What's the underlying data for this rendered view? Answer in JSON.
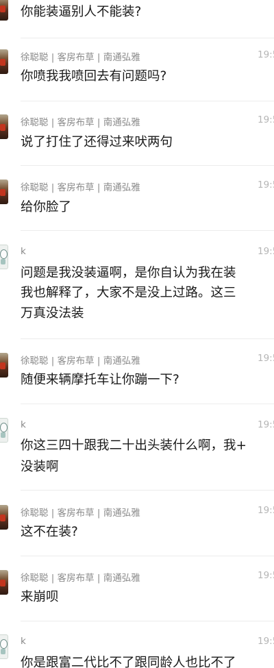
{
  "messages": [
    {
      "sender": "",
      "time": "",
      "lines": [
        "你能装逼别人不能装?"
      ]
    },
    {
      "sender": "徐聪聪 | 客房布草 | 南通弘雅",
      "time": "19:5",
      "lines": [
        "你喷我我喷回去有问题吗?"
      ]
    },
    {
      "sender": "徐聪聪 | 客房布草 | 南通弘雅",
      "time": "19:5",
      "lines": [
        "说了打住了还得过来吠两句"
      ]
    },
    {
      "sender": "徐聪聪 | 客房布草 | 南通弘雅",
      "time": "19:5",
      "lines": [
        "给你脸了"
      ]
    },
    {
      "sender": "k",
      "time": "19:5",
      "lines": [
        "问题是我没装逼啊，是你自认为我在装",
        "我也解释了，大家不是没上过路。这三",
        "万真没法装"
      ]
    },
    {
      "sender": "徐聪聪 | 客房布草 | 南通弘雅",
      "time": "19:5",
      "lines": [
        "随便来辆摩托车让你蹦一下?"
      ]
    },
    {
      "sender": "k",
      "time": "19:5",
      "lines": [
        "你这三四十跟我二十出头装什么啊，我+",
        "没装啊"
      ]
    },
    {
      "sender": "徐聪聪 | 客房布草 | 南通弘雅",
      "time": "19:5",
      "lines": [
        "这不在装?"
      ]
    },
    {
      "sender": "徐聪聪 | 客房布草 | 南通弘雅",
      "time": "19:5",
      "lines": [
        "来崩呗"
      ]
    },
    {
      "sender": "k",
      "time": "19:5",
      "lines": [
        "你是跟富二代比不了跟同龄人也比不了"
      ]
    }
  ]
}
